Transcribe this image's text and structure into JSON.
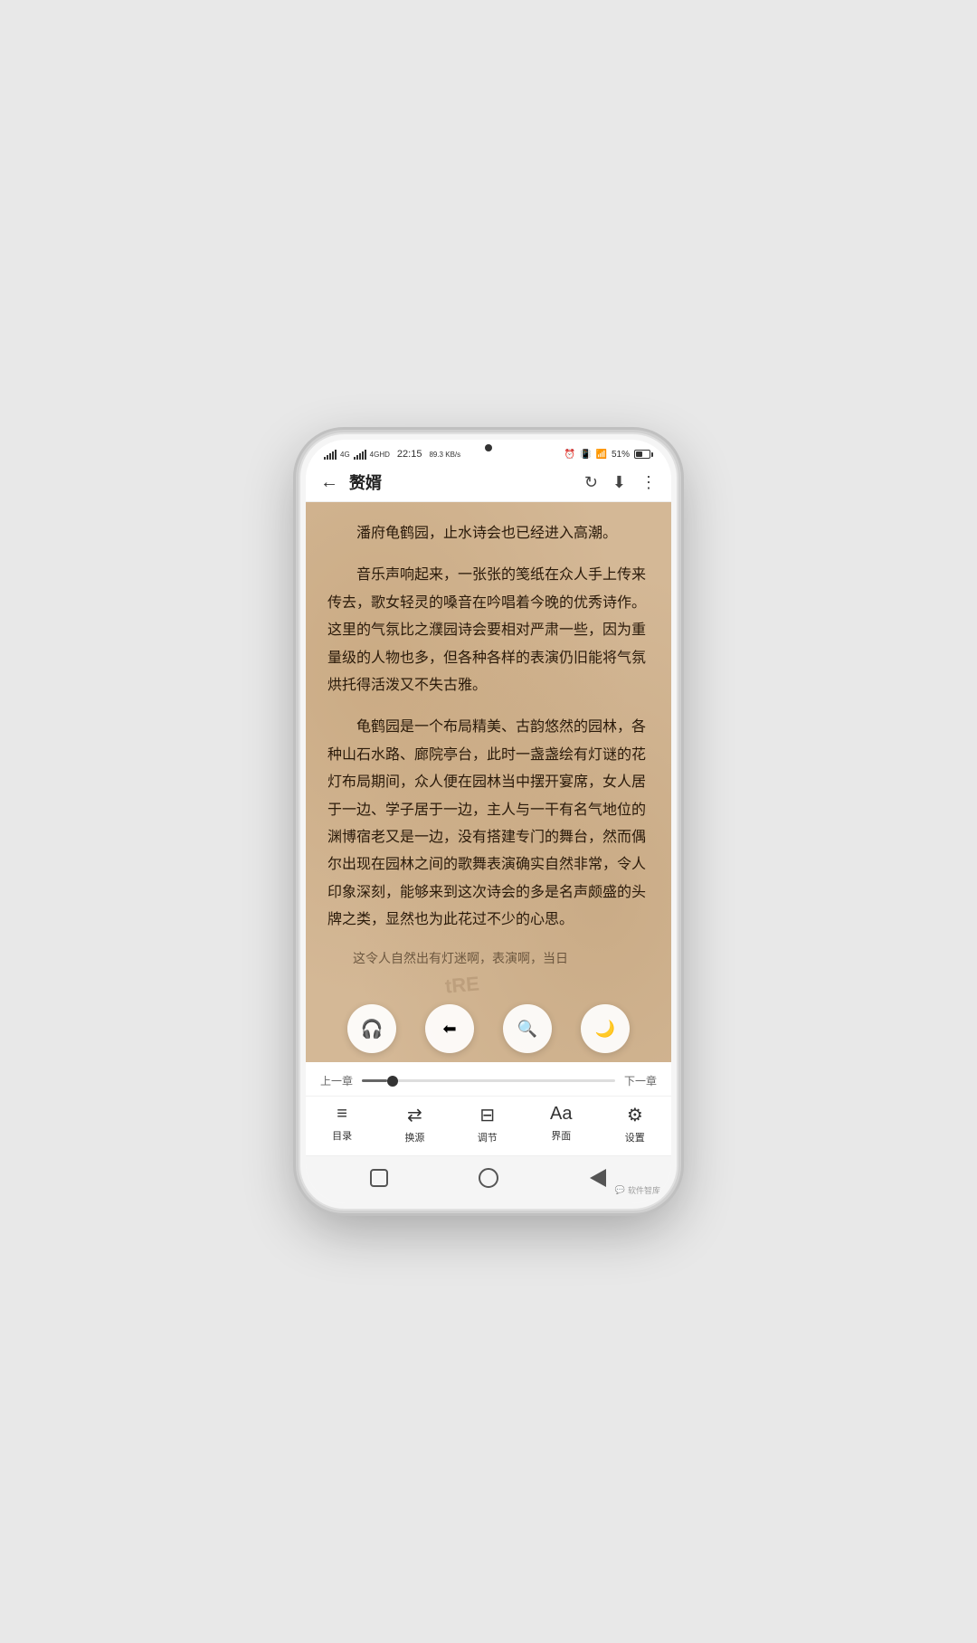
{
  "status": {
    "network": "4G",
    "network2": "4GHD",
    "time": "22:15",
    "speed": "89.3 KB/s",
    "battery_pct": "51%",
    "signal_bars": [
      3,
      5,
      7,
      9,
      11
    ]
  },
  "nav": {
    "back_icon": "←",
    "title": "赘婿",
    "refresh_icon": "↻",
    "download_icon": "⬇",
    "more_icon": "⋮"
  },
  "reading": {
    "paragraphs": [
      "潘府龟鹤园，止水诗会也已经进入高潮。",
      "音乐声响起来，一张张的笺纸在众人手上传来传去，歌女轻灵的嗓音在吟唱着今晚的优秀诗作。这里的气氛比之濮园诗会要相对严肃一些，因为重量级的人物也多，但各种各样的表演仍旧能将气氛烘托得活泼又不失古雅。",
      "龟鹤园是一个布局精美、古韵悠然的园林，各种山石水路、廊院亭台，此时一盏盏绘有灯谜的花灯布局期间，众人便在园林当中摆开宴席，女人居于一边、学子居于一边，主人与一干有名气地位的渊博宿老又是一边，没有搭建专门的舞台，然而偶尔出现在园林之间的歌舞表演确实自然非常，令人印象深刻，能够来到这次诗会的多是名声颇盛的头牌之类，显然也为此花过不少的心思。",
      "这令人自然出有灯迷啊，表演啊，当日"
    ]
  },
  "float_buttons": [
    {
      "icon": "🎧",
      "name": "audio"
    },
    {
      "icon": "⬅",
      "name": "back-reading"
    },
    {
      "icon": "🔍",
      "name": "search"
    },
    {
      "icon": "🌙",
      "name": "night-mode"
    }
  ],
  "bottom": {
    "prev_chapter": "上一章",
    "next_chapter": "下一章",
    "progress": 10
  },
  "toolbar": {
    "items": [
      {
        "icon": "≡",
        "label": "目录"
      },
      {
        "icon": "⇄",
        "label": "换源"
      },
      {
        "icon": "⊟",
        "label": "调节"
      },
      {
        "icon": "Aa",
        "label": "界面"
      },
      {
        "icon": "⚙",
        "label": "设置"
      }
    ]
  },
  "watermark": "软件智库"
}
